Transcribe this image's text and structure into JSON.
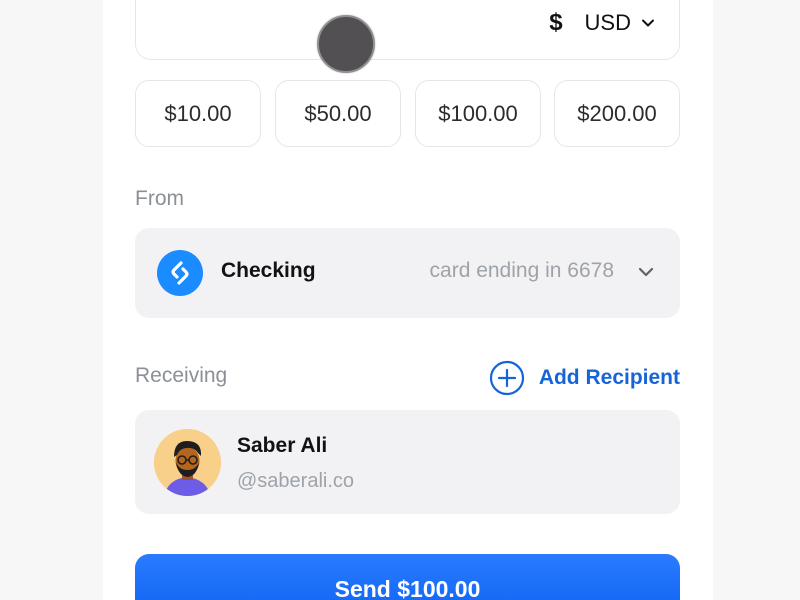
{
  "amount_field": {
    "currency_symbol": "$",
    "currency_code": "USD"
  },
  "presets": [
    "$10.00",
    "$50.00",
    "$100.00",
    "$200.00"
  ],
  "from": {
    "label": "From",
    "account_name": "Checking",
    "account_detail": "card ending in 6678"
  },
  "receiving": {
    "label": "Receiving",
    "add_recipient_label": "Add Recipient",
    "recipient_name": "Saber Ali",
    "recipient_handle": "@saberali.co"
  },
  "send_button_label": "Send $100.00",
  "colors": {
    "accent": "#1665d8",
    "primary_button": "#0a66ff",
    "card_bg": "#f2f2f4",
    "muted_text": "#9ea3aa"
  },
  "icons": {
    "currency": "dollar-icon",
    "dropdown": "chevron-down-icon",
    "account_logo": "bank-logo-icon",
    "add": "plus-circle-icon"
  }
}
